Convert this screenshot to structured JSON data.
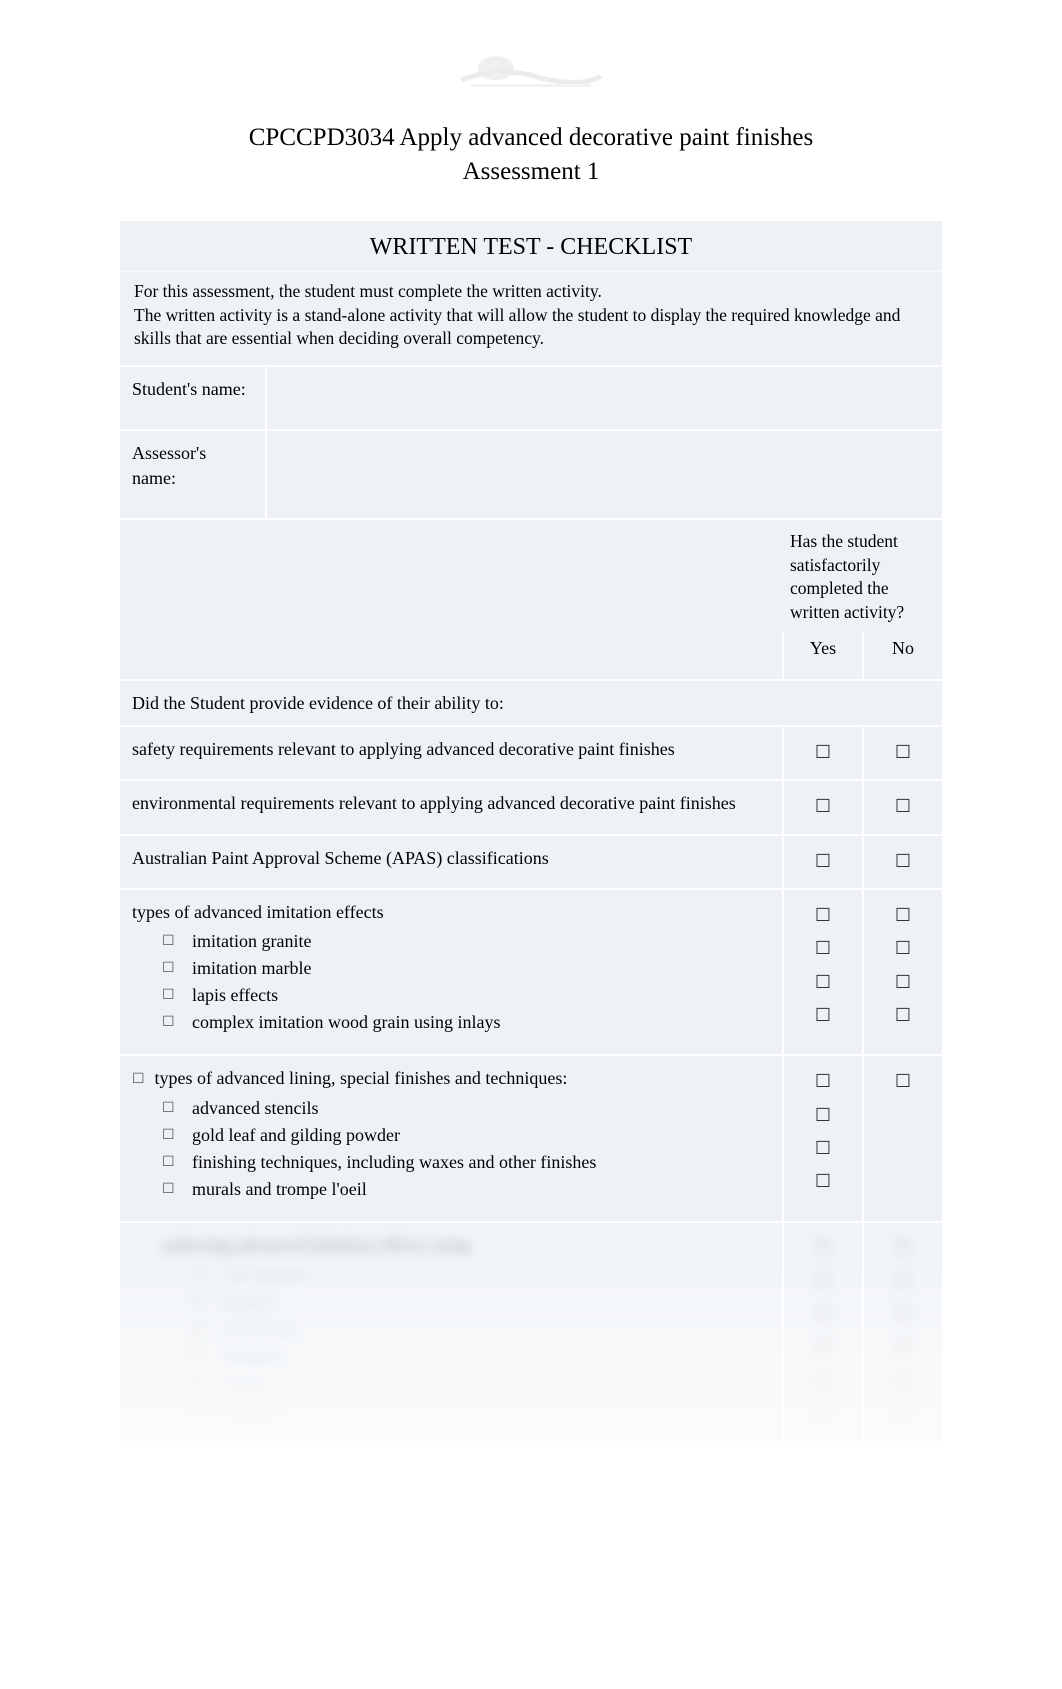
{
  "header": {
    "title_line1": "CPCCPD3034 Apply advanced decorative paint finishes",
    "title_line2": "Assessment 1"
  },
  "section": {
    "heading": "WRITTEN TEST - CHECKLIST",
    "intro_line1": "For this assessment, the student must complete the written activity.",
    "intro_line2": "The written activity is a stand-alone activity that will allow the student to display the required knowledge and skills that are essential when deciding overall competency."
  },
  "fields": {
    "student_label": "Student's name:",
    "student_value": "",
    "assessor_label": "Assessor's name:",
    "assessor_value": ""
  },
  "eval_header": {
    "question": "Has the student satisfactorily completed the written activity?",
    "yes": "Yes",
    "no": "No"
  },
  "criteria_intro": "Did the Student provide evidence of their ability to:",
  "criteria": [
    {
      "text": "safety requirements relevant to applying advanced decorative paint finishes",
      "yes_marks": 1,
      "no_marks": 1,
      "justify": false
    },
    {
      "text": "environmental requirements relevant to applying advanced decorative paint finishes",
      "yes_marks": 1,
      "no_marks": 1,
      "justify": true
    },
    {
      "text": "Australian Paint Approval Scheme (APAS) classifications",
      "yes_marks": 1,
      "no_marks": 1,
      "justify": false
    }
  ],
  "criteria_list_1": {
    "lead": "types of advanced imitation effects",
    "items": [
      "imitation granite",
      "imitation marble",
      "lapis effects",
      "complex imitation wood grain using inlays"
    ],
    "yes_marks": 4,
    "no_marks": 4
  },
  "criteria_list_2": {
    "lead": "types of advanced lining, special finishes and techniques:",
    "items": [
      "advanced stencils",
      "gold leaf and gilding powder",
      "finishing techniques, including waxes and other finishes",
      "murals and trompe l'oeil"
    ],
    "yes_marks": 4,
    "no_marks": 1
  },
  "criteria_list_3": {
    "lead": "achieving advanced imitation effects using",
    "items": [
      "faux/granite",
      "sponge",
      "cotton/rag",
      "dragging",
      "colour",
      "scumble"
    ],
    "yes_marks": 6,
    "no_marks": 6
  },
  "glyphs": {
    "checkbox": "☐",
    "bullet": "☐"
  }
}
